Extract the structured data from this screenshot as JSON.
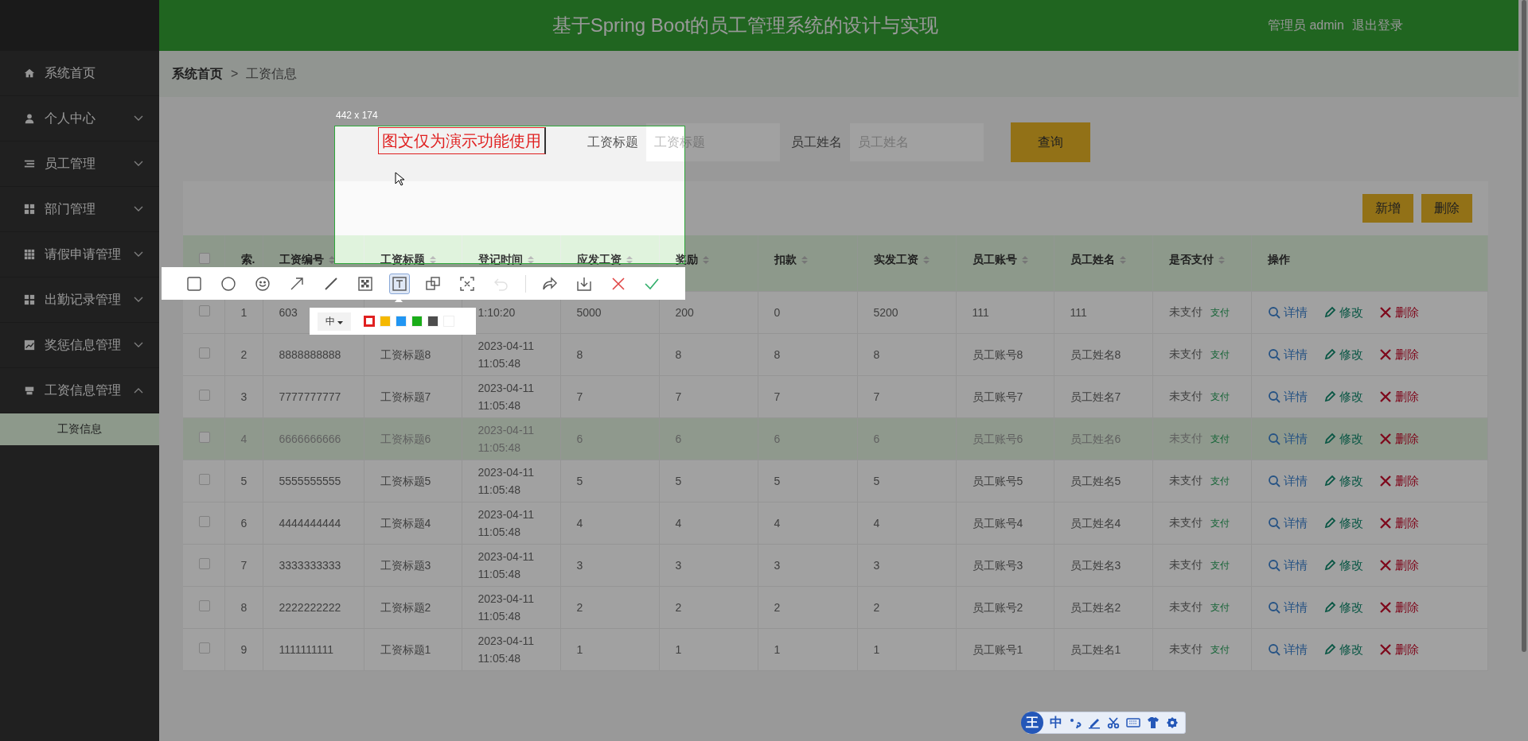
{
  "header": {
    "title": "基于Spring Boot的员工管理系统的设计与实现",
    "user": "管理员 admin",
    "logout": "退出登录"
  },
  "sidebar": {
    "items": [
      {
        "label": "系统首页"
      },
      {
        "label": "个人中心",
        "expanded": false
      },
      {
        "label": "员工管理",
        "expanded": false
      },
      {
        "label": "部门管理",
        "expanded": false
      },
      {
        "label": "请假申请管理",
        "expanded": false
      },
      {
        "label": "出勤记录管理",
        "expanded": false
      },
      {
        "label": "奖惩信息管理",
        "expanded": false
      },
      {
        "label": "工资信息管理",
        "expanded": true,
        "children": [
          {
            "label": "工资信息",
            "selected": true
          }
        ]
      }
    ]
  },
  "breadcrumb": [
    "系统首页",
    ">",
    "工资信息"
  ],
  "search": {
    "fields": [
      {
        "label": "工资标题",
        "placeholder": "工资标题"
      },
      {
        "label": "员工姓名",
        "placeholder": "员工姓名"
      }
    ],
    "button": "查询"
  },
  "actions": [
    "新增",
    "删除"
  ],
  "table": {
    "select_all": {
      "checked": false
    },
    "columns": [
      {
        "label": "索.",
        "sortable": false
      },
      {
        "label": "工资编号",
        "sortable": true
      },
      {
        "label": "工资标题",
        "sortable": true
      },
      {
        "label": "登记时间",
        "sortable": true
      },
      {
        "label": "应发工资",
        "sortable": true
      },
      {
        "label": "奖励",
        "sortable": true
      },
      {
        "label": "扣款",
        "sortable": true
      },
      {
        "label": "实发工资",
        "sortable": true
      },
      {
        "label": "员工账号",
        "sortable": true
      },
      {
        "label": "员工姓名",
        "sortable": true
      },
      {
        "label": "是否支付",
        "sortable": true
      },
      {
        "label": "操作",
        "sortable": false
      }
    ],
    "rows": [
      {
        "checked": false,
        "highlighted": false,
        "cells": [
          "1",
          "603",
          "",
          "1:10:20",
          "5000",
          "200",
          "0",
          "5200",
          "111",
          "111"
        ],
        "status": "未支付",
        "pay": "支付"
      },
      {
        "checked": false,
        "highlighted": false,
        "cells": [
          "2",
          "8888888888",
          "工资标题8",
          "2023-04-11 11:05:48",
          "8",
          "8",
          "8",
          "8",
          "员工账号8",
          "员工姓名8"
        ],
        "status": "未支付",
        "pay": "支付"
      },
      {
        "checked": false,
        "highlighted": false,
        "cells": [
          "3",
          "7777777777",
          "工资标题7",
          "2023-04-11 11:05:48",
          "7",
          "7",
          "7",
          "7",
          "员工账号7",
          "员工姓名7"
        ],
        "status": "未支付",
        "pay": "支付"
      },
      {
        "checked": false,
        "highlighted": true,
        "cells": [
          "4",
          "6666666666",
          "工资标题6",
          "2023-04-11 11:05:48",
          "6",
          "6",
          "6",
          "6",
          "员工账号6",
          "员工姓名6"
        ],
        "status": "未支付",
        "pay": "支付"
      },
      {
        "checked": false,
        "highlighted": false,
        "cells": [
          "5",
          "5555555555",
          "工资标题5",
          "2023-04-11 11:05:48",
          "5",
          "5",
          "5",
          "5",
          "员工账号5",
          "员工姓名5"
        ],
        "status": "未支付",
        "pay": "支付"
      },
      {
        "checked": false,
        "highlighted": false,
        "cells": [
          "6",
          "4444444444",
          "工资标题4",
          "2023-04-11 11:05:48",
          "4",
          "4",
          "4",
          "4",
          "员工账号4",
          "员工姓名4"
        ],
        "status": "未支付",
        "pay": "支付"
      },
      {
        "checked": false,
        "highlighted": false,
        "cells": [
          "7",
          "3333333333",
          "工资标题3",
          "2023-04-11 11:05:48",
          "3",
          "3",
          "3",
          "3",
          "员工账号3",
          "员工姓名3"
        ],
        "status": "未支付",
        "pay": "支付"
      },
      {
        "checked": false,
        "highlighted": false,
        "cells": [
          "8",
          "2222222222",
          "工资标题2",
          "2023-04-11 11:05:48",
          "2",
          "2",
          "2",
          "2",
          "员工账号2",
          "员工姓名2"
        ],
        "status": "未支付",
        "pay": "支付"
      },
      {
        "checked": false,
        "highlighted": false,
        "cells": [
          "9",
          "1111111111",
          "工资标题1",
          "2023-04-11 11:05:48",
          "1",
          "1",
          "1",
          "1",
          "员工账号1",
          "员工姓名1"
        ],
        "status": "未支付",
        "pay": "支付"
      }
    ],
    "row_actions": [
      [
        {
          "kind": "view",
          "label": "详情"
        },
        {
          "kind": "edit",
          "label": "修改"
        },
        {
          "kind": "delete",
          "label": "删除"
        }
      ],
      [
        {
          "kind": "view",
          "label": "详情"
        },
        {
          "kind": "edit",
          "label": "修改"
        },
        {
          "kind": "delete",
          "label": "删除"
        }
      ],
      [
        {
          "kind": "view",
          "label": "详情"
        },
        {
          "kind": "edit",
          "label": "修改"
        },
        {
          "kind": "delete",
          "label": "删除"
        }
      ],
      [
        {
          "kind": "view",
          "label": "详情"
        },
        {
          "kind": "edit",
          "label": "修改"
        },
        {
          "kind": "delete",
          "label": "删除"
        }
      ],
      [
        {
          "kind": "view",
          "label": "详情"
        },
        {
          "kind": "edit",
          "label": "修改"
        },
        {
          "kind": "delete",
          "label": "删除"
        }
      ],
      [
        {
          "kind": "view",
          "label": "详情"
        },
        {
          "kind": "edit",
          "label": "修改"
        },
        {
          "kind": "delete",
          "label": "删除"
        }
      ],
      [
        {
          "kind": "view",
          "label": "详情"
        },
        {
          "kind": "edit",
          "label": "修改"
        },
        {
          "kind": "delete",
          "label": "删除"
        }
      ],
      [
        {
          "kind": "view",
          "label": "详情"
        },
        {
          "kind": "edit",
          "label": "修改"
        },
        {
          "kind": "delete",
          "label": "删除"
        }
      ],
      [
        {
          "kind": "view",
          "label": "详情"
        },
        {
          "kind": "edit",
          "label": "修改"
        },
        {
          "kind": "delete",
          "label": "删除"
        }
      ]
    ]
  },
  "capture": {
    "size": "442 x 174",
    "annotation": "图文仅为演示功能使用",
    "tools": [
      {
        "kind": "rect",
        "selected": false,
        "disabled": false
      },
      {
        "kind": "ellipse",
        "selected": false,
        "disabled": false
      },
      {
        "kind": "emoji",
        "selected": false,
        "disabled": false
      },
      {
        "kind": "arrow",
        "selected": false,
        "disabled": false
      },
      {
        "kind": "pen",
        "selected": false,
        "disabled": false
      },
      {
        "kind": "mosaic",
        "selected": false,
        "disabled": false
      },
      {
        "kind": "text",
        "selected": true,
        "disabled": false
      },
      {
        "kind": "translate",
        "selected": false,
        "disabled": false
      },
      {
        "kind": "ocr",
        "selected": false,
        "disabled": false
      },
      {
        "kind": "undo",
        "selected": false,
        "disabled": true
      },
      {
        "kind": "share",
        "selected": false,
        "disabled": false
      },
      {
        "kind": "save",
        "selected": false,
        "disabled": false
      },
      {
        "kind": "cancel",
        "selected": false,
        "disabled": false
      },
      {
        "kind": "done",
        "selected": false,
        "disabled": false
      }
    ],
    "font_size": "中",
    "colors": [
      {
        "color": "#e02020",
        "selected": true
      },
      {
        "color": "#f5b800",
        "selected": false
      },
      {
        "color": "#2196f3",
        "selected": false
      },
      {
        "color": "#1aad19",
        "selected": false
      },
      {
        "color": "#4d4d4d",
        "selected": false
      },
      {
        "color": "#ffffff",
        "selected": false
      }
    ]
  },
  "ime_toolbar": {
    "logo": "王",
    "mode": "中"
  }
}
